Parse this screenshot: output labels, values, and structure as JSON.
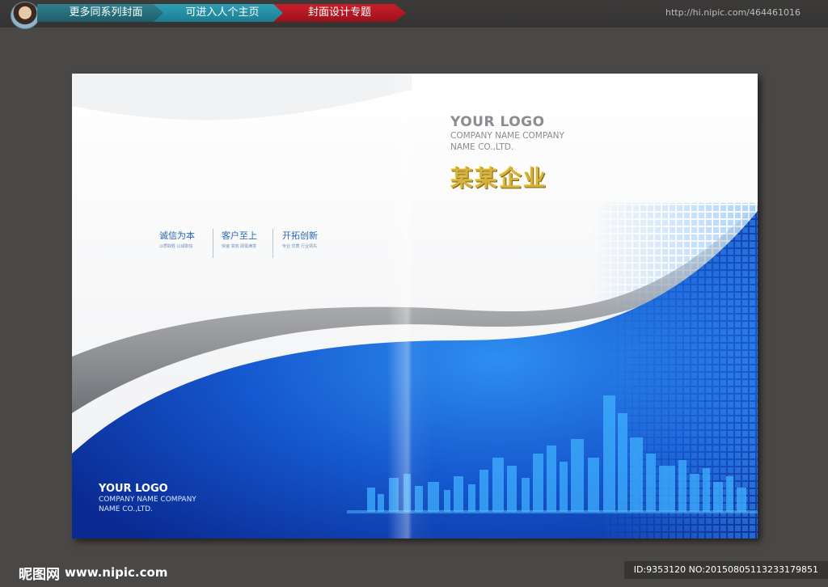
{
  "nav": {
    "tabs": [
      "更多同系列封面",
      "可进入人个主页",
      "封面设计专题"
    ],
    "url": "http://hi.nipic.com/464461016"
  },
  "cover": {
    "logo_right": {
      "title": "YOUR LOGO",
      "line1": "COMPANY NAME COMPANY",
      "line2": "NAME CO.,LTD."
    },
    "company_title": "某某企业",
    "mottos": [
      {
        "main": "诚信为本",
        "sub": "以质取胜 以诚取信"
      },
      {
        "main": "客户至上",
        "sub": "快速 高效 即需满意"
      },
      {
        "main": "开拓创新",
        "sub": "专业 优质 行业领先"
      }
    ],
    "logo_left": {
      "title": "YOUR LOGO",
      "line1": "COMPANY NAME COMPANY",
      "line2": "NAME CO.,LTD."
    }
  },
  "watermark": {
    "logo": "昵图网",
    "url": "www.nipic.com",
    "id_text": "ID:9353120 NO:20150805113233179851"
  },
  "colors": {
    "blue": "#1f5ec8",
    "dark_blue": "#0b2f9a",
    "gold": "#d7b23a",
    "nav_red": "#c81f2a",
    "nav_teal": "#2f9fb3"
  }
}
